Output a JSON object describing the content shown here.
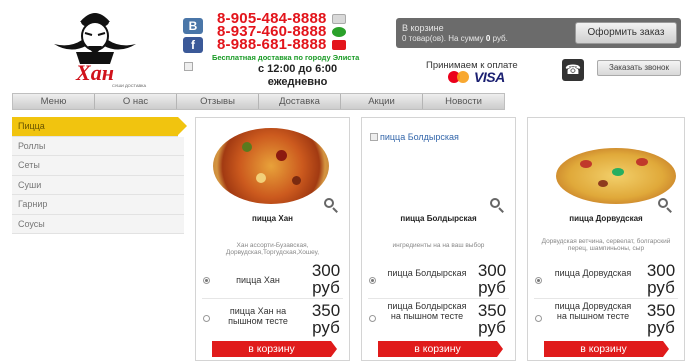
{
  "brand": {
    "logo_text": "Хан",
    "logo_tagline": "СУШИ ДОСТАВКА"
  },
  "social": {
    "vk": "B",
    "fb": "f"
  },
  "phones": [
    "8-905-484-8888",
    "8-937-460-8888",
    "8-988-681-8888"
  ],
  "delivery_note": "Бесплатная доставка по городу Элиста",
  "hours": {
    "time": "с 12:00 до 6:00",
    "days": "ежедневно"
  },
  "cart": {
    "title": "В корзине",
    "info_prefix": "0 товар(ов). На сумму ",
    "info_sum": "0",
    "info_suffix": " руб.",
    "order_button": "Оформить заказ"
  },
  "payment": {
    "label": "Принимаем к оплате",
    "visa": "VISA"
  },
  "callback_button": "Заказать звонок",
  "nav": [
    "Меню",
    "О нас",
    "Отзывы",
    "Доставка",
    "Акции",
    "Новости"
  ],
  "sidebar": [
    "Пицца",
    "Роллы",
    "Сеты",
    "Суши",
    "Гарнир",
    "Соусы"
  ],
  "products": [
    {
      "title": "пицца Хан",
      "description": "Хан ассорти-Бузавская, Дорвудская,Торгудская,Хошеу,",
      "options": [
        {
          "name": "пицца Хан",
          "price": "300 руб"
        },
        {
          "name": "пицца Хан на пышном тесте",
          "price": "350 руб"
        }
      ],
      "button": "в корзину"
    },
    {
      "title": "пицца Болдырская",
      "image_alt": "пицца Болдырская",
      "description": "ингредиенты на на ваш выбор",
      "options": [
        {
          "name": "пицца Болдырская",
          "price": "300 руб"
        },
        {
          "name": "пицца Болдырская на пышном тесте",
          "price": "350 руб"
        }
      ],
      "button": "в корзину"
    },
    {
      "title": "пицца Дорвудская",
      "description": "Дорвудская ветчина, сервелат, болгарский перец, шампиньоны, сыр",
      "options": [
        {
          "name": "пицца Дорвудская",
          "price": "300 руб"
        },
        {
          "name": "пицца Дорвудская на пышном тесте",
          "price": "350 руб"
        }
      ],
      "button": "в корзину"
    }
  ],
  "colors": {
    "accent": "#e01b1b",
    "phone": "#e3141b",
    "sidebar_active": "#f1c40f",
    "note": "#1a9b26"
  }
}
